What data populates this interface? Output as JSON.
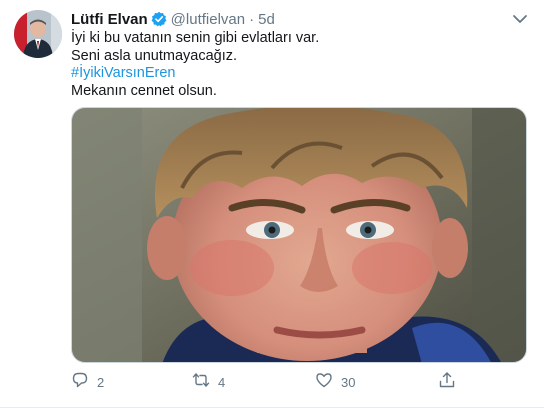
{
  "tweet": {
    "author_name": "Lütfi Elvan",
    "handle": "@lutfielvan",
    "separator": "·",
    "time": "5d",
    "lines": [
      "İyi ki bu vatanın senin gibi evlatları var.",
      "Seni asla unutmayacağız.",
      "#İyikiVarsınEren",
      "Mekanın cennet olsun."
    ],
    "counts": {
      "replies": "2",
      "retweets": "4",
      "likes": "30"
    }
  },
  "colors": {
    "accent": "#1da1f2",
    "link": "#1b95e0",
    "muted": "#657786",
    "text": "#14171a"
  },
  "icons": {
    "verified": "verified-badge-icon",
    "caret": "chevron-down-icon",
    "reply": "reply-bubble-icon",
    "retweet": "retweet-icon",
    "like": "heart-icon",
    "share": "share-icon"
  }
}
